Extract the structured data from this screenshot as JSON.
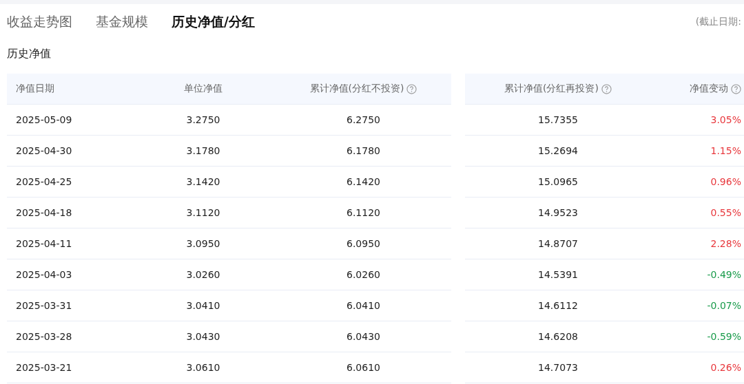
{
  "tabs": [
    {
      "label": "收益走势图",
      "selected": false
    },
    {
      "label": "基金规模",
      "selected": false
    },
    {
      "label": "历史净值/分红",
      "selected": true
    }
  ],
  "as_of_label": "(截止日期:",
  "section_title": "历史净值",
  "table": {
    "columns": [
      {
        "label": "净值日期"
      },
      {
        "label": "单位净值"
      },
      {
        "label": "累计净值(分红不投资)",
        "help": true
      },
      {
        "label": "累计净值(分红再投资)",
        "help": true
      },
      {
        "label": "净值变动",
        "help": true
      }
    ],
    "rows": [
      {
        "date": "2025-05-09",
        "nav": "3.2750",
        "cum_nav": "6.2750",
        "cum_reinvest": "15.7355",
        "change": "3.05%",
        "color": "#e8383d"
      },
      {
        "date": "2025-04-30",
        "nav": "3.1780",
        "cum_nav": "6.1780",
        "cum_reinvest": "15.2694",
        "change": "1.15%",
        "color": "#e8383d"
      },
      {
        "date": "2025-04-25",
        "nav": "3.1420",
        "cum_nav": "6.1420",
        "cum_reinvest": "15.0965",
        "change": "0.96%",
        "color": "#e8383d"
      },
      {
        "date": "2025-04-18",
        "nav": "3.1120",
        "cum_nav": "6.1120",
        "cum_reinvest": "14.9523",
        "change": "0.55%",
        "color": "#e8383d"
      },
      {
        "date": "2025-04-11",
        "nav": "3.0950",
        "cum_nav": "6.0950",
        "cum_reinvest": "14.8707",
        "change": "2.28%",
        "color": "#e8383d"
      },
      {
        "date": "2025-04-03",
        "nav": "3.0260",
        "cum_nav": "6.0260",
        "cum_reinvest": "14.5391",
        "change": "-0.49%",
        "color": "#1a9b4b"
      },
      {
        "date": "2025-03-31",
        "nav": "3.0410",
        "cum_nav": "6.0410",
        "cum_reinvest": "14.6112",
        "change": "-0.07%",
        "color": "#1a9b4b"
      },
      {
        "date": "2025-03-28",
        "nav": "3.0430",
        "cum_nav": "6.0430",
        "cum_reinvest": "14.6208",
        "change": "-0.59%",
        "color": "#1a9b4b"
      },
      {
        "date": "2025-03-21",
        "nav": "3.0610",
        "cum_nav": "6.0610",
        "cum_reinvest": "14.7073",
        "change": "0.26%",
        "color": "#e8383d"
      }
    ]
  }
}
